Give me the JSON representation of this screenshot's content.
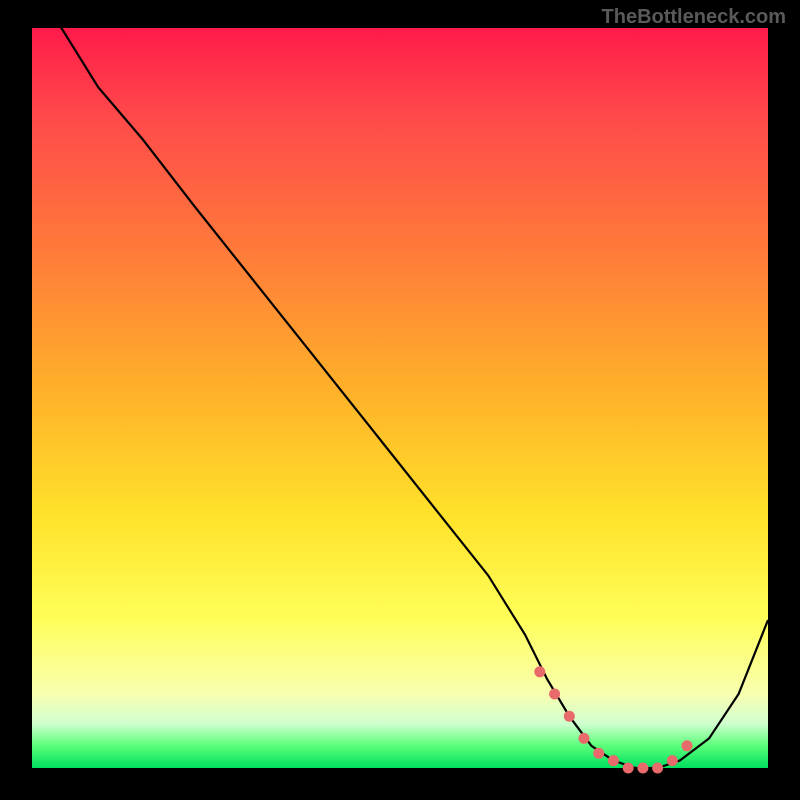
{
  "watermark": "TheBottleneck.com",
  "chart_data": {
    "type": "line",
    "title": "",
    "xlabel": "",
    "ylabel": "",
    "xlim": [
      0,
      100
    ],
    "ylim": [
      0,
      100
    ],
    "grid": false,
    "series": [
      {
        "name": "bottleneck-curve",
        "x": [
          0,
          4,
          9,
          15,
          22,
          30,
          38,
          46,
          54,
          62,
          67,
          70,
          73,
          76,
          79,
          82,
          85,
          88,
          92,
          96,
          100
        ],
        "values": [
          108,
          100,
          92,
          85,
          76,
          66,
          56,
          46,
          36,
          26,
          18,
          12,
          7,
          3,
          1,
          0,
          0,
          1,
          4,
          10,
          20
        ]
      }
    ],
    "markers": {
      "name": "selected-range",
      "x": [
        69,
        71,
        73,
        75,
        77,
        79,
        81,
        83,
        85,
        87,
        89
      ],
      "values": [
        13,
        10,
        7,
        4,
        2,
        1,
        0,
        0,
        0,
        1,
        3
      ]
    }
  }
}
